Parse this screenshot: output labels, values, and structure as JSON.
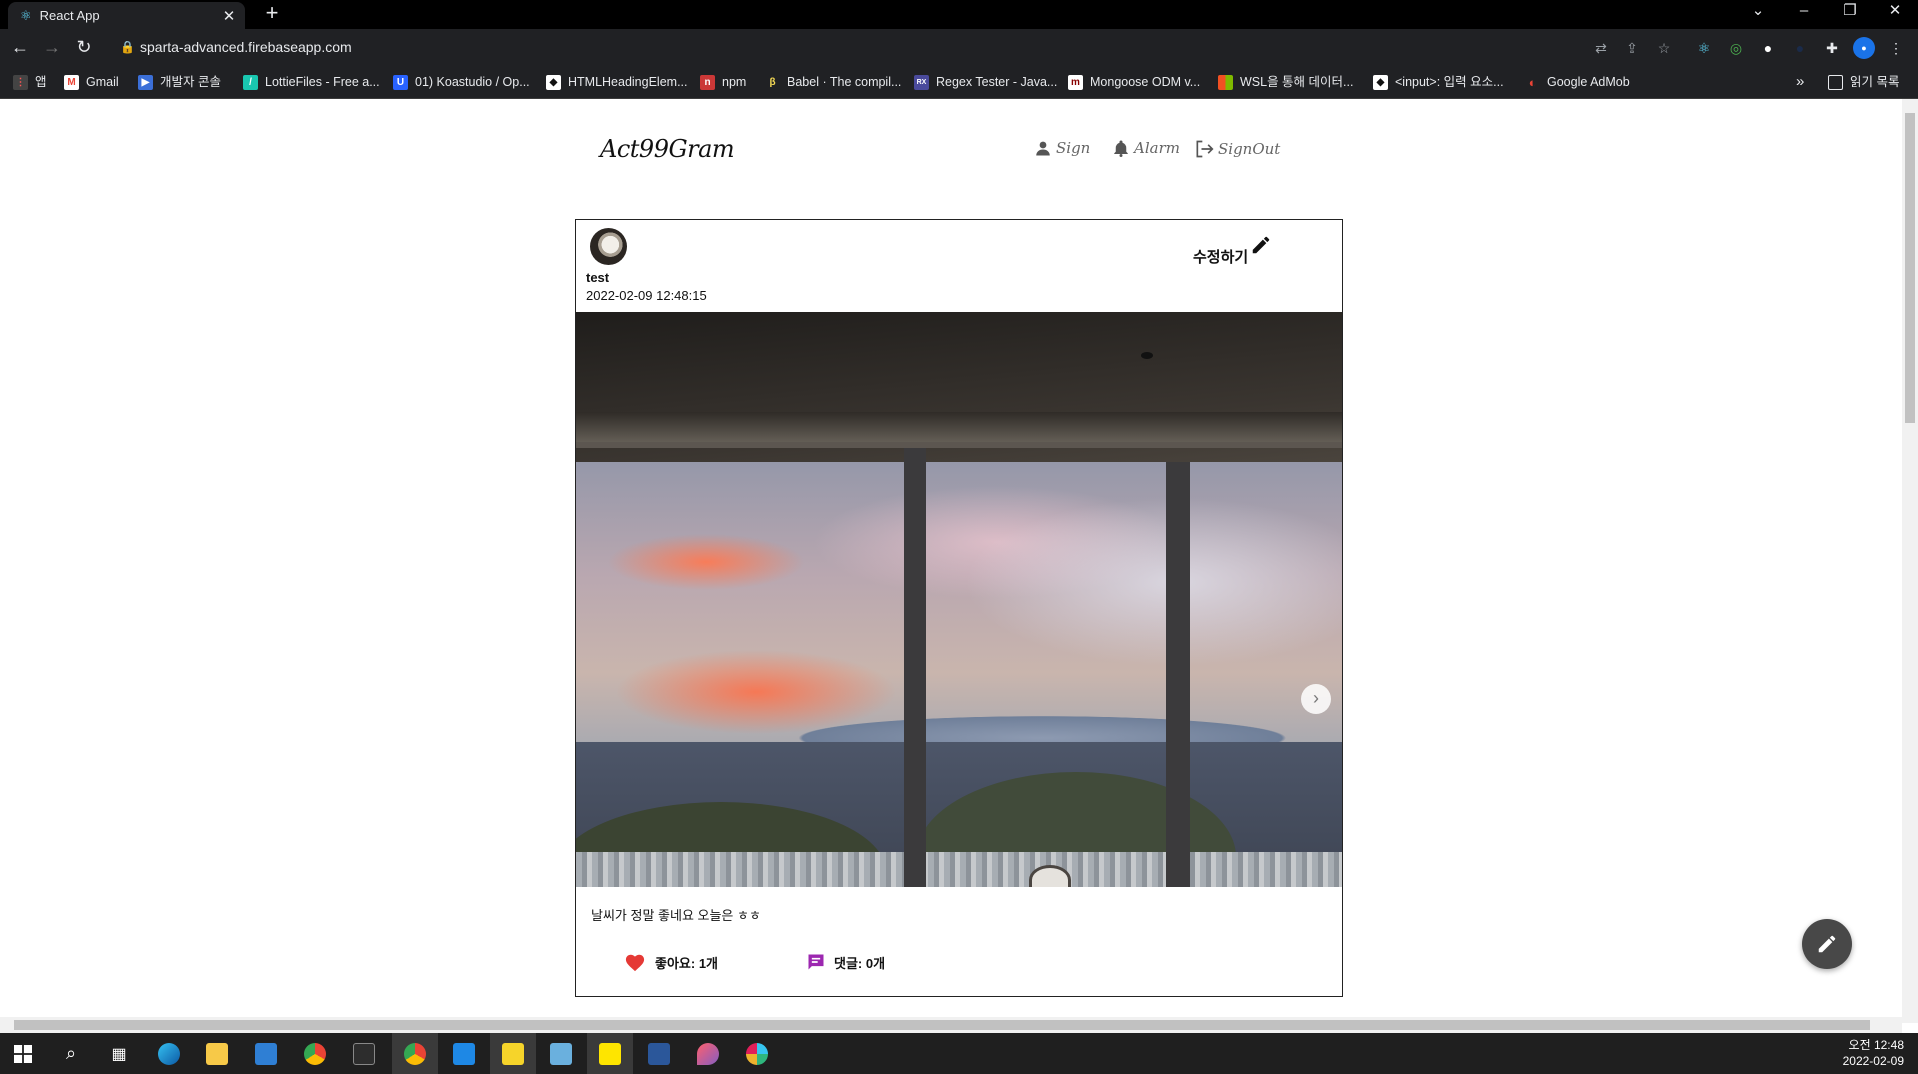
{
  "browser": {
    "tab_title": "React App",
    "url": "sparta-advanced.firebaseapp.com",
    "bookmarks": [
      {
        "label": "앱",
        "color": "#e44"
      },
      {
        "label": "Gmail",
        "color": "#ea4335"
      },
      {
        "label": "개발자 콘솔",
        "color": "#3b6fd8"
      },
      {
        "label": "LottieFiles - Free a...",
        "color": "#19c7b0"
      },
      {
        "label": "01) Koastudio / Op...",
        "color": "#2962ff"
      },
      {
        "label": "HTMLHeadingElem...",
        "color": "#111111"
      },
      {
        "label": "npm",
        "color": "#cb3837"
      },
      {
        "label": "Babel · The compil...",
        "color": "#f5da55"
      },
      {
        "label": "Regex Tester - Java...",
        "color": "#4a4a9c"
      },
      {
        "label": "Mongoose ODM v...",
        "color": "#880000"
      },
      {
        "label": "WSL을 통해 데이터...",
        "color": "#f25022"
      },
      {
        "label": "<input>: 입력 요소...",
        "color": "#111111"
      },
      {
        "label": "Google AdMob",
        "color": "#ea4335"
      }
    ],
    "more_label": "»",
    "reading_list": "읽기 목록"
  },
  "header": {
    "logo": "Act99Gram",
    "nav": [
      {
        "label": "Sign",
        "icon": "user-icon"
      },
      {
        "label": "Alarm",
        "icon": "bell-icon"
      },
      {
        "label": "SignOut",
        "icon": "logout-icon"
      }
    ]
  },
  "post": {
    "username": "test",
    "datetime": "2022-02-09 12:48:15",
    "edit_label": "수정하기",
    "content": "날씨가 정말 좋네요 오늘은 ㅎㅎ",
    "likes_label": "좋아요: 1개",
    "comments_label": "댓글: 0개",
    "like_color": "#e53935",
    "comment_color": "#9c27b0"
  },
  "taskbar": {
    "time": "오전 12:48",
    "date": "2022-02-09"
  }
}
